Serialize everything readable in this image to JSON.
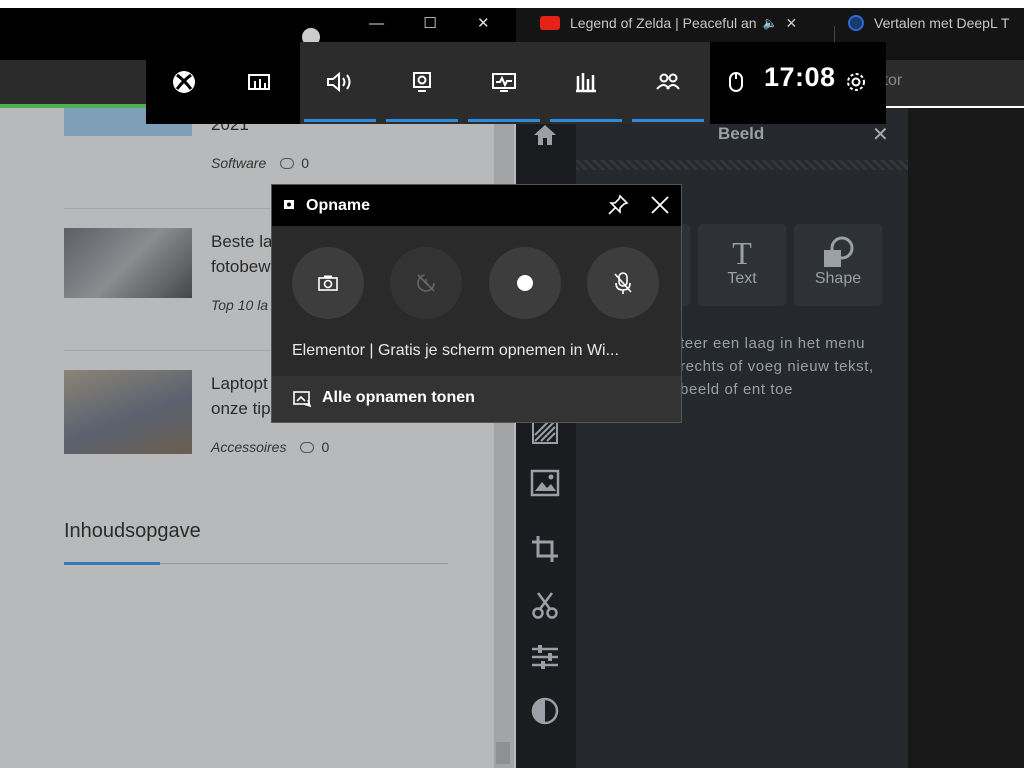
{
  "browser": {
    "tabs": [
      {
        "title": "Legend of Zelda | Peaceful an",
        "icon": "youtube-icon"
      },
      {
        "title": "Vertalen met DeepL T",
        "icon": "deepl-icon"
      }
    ],
    "sub_right_text": "itor",
    "window_controls": {
      "minimize": "—",
      "maximize": "☐",
      "close": "✕"
    },
    "tab_close": "✕",
    "audio_glyph": "🔈"
  },
  "webpage": {
    "articles": [
      {
        "title_lines": [
          "2021"
        ],
        "category": "Software",
        "comments": "0"
      },
      {
        "title_lines": [
          "Beste la",
          "fotobew"
        ],
        "category": "Top 10 la",
        "comments": ""
      },
      {
        "title_lines": [
          "Laptopt",
          "onze tip"
        ],
        "category": "Accessoires",
        "comments": "0"
      }
    ],
    "toc_title": "Inhoudsopgave"
  },
  "editor": {
    "panel_title": "Beeld",
    "panel_close": "✕",
    "tools": [
      {
        "label": "Text",
        "icon": "text-tool-icon",
        "glyph": "T"
      },
      {
        "label": "Shape",
        "icon": "shape-tool-icon"
      }
    ],
    "hint_text": "teer een laag in het menu rechts of voeg nieuw tekst, beeld of ent toe",
    "rail_icons": [
      "home-icon",
      "pattern-icon",
      "image-icon",
      "crop-icon",
      "scissors-icon",
      "sliders-icon",
      "contrast-icon"
    ]
  },
  "gamebar": {
    "time": "17:08",
    "widgets": [
      "xbox-icon",
      "widget-menu-icon",
      "audio-icon",
      "capture-icon",
      "performance-icon",
      "resources-icon",
      "xbox-social-icon"
    ],
    "status_icons": [
      "mouse-icon",
      "settings-icon"
    ]
  },
  "capture": {
    "title": "Opname",
    "file_name": "Elementor | Gratis je scherm opnemen in Wi...",
    "show_all": "Alle opnamen tonen",
    "buttons": [
      "screenshot-button",
      "record-last-button",
      "record-button",
      "mic-toggle-button"
    ]
  }
}
